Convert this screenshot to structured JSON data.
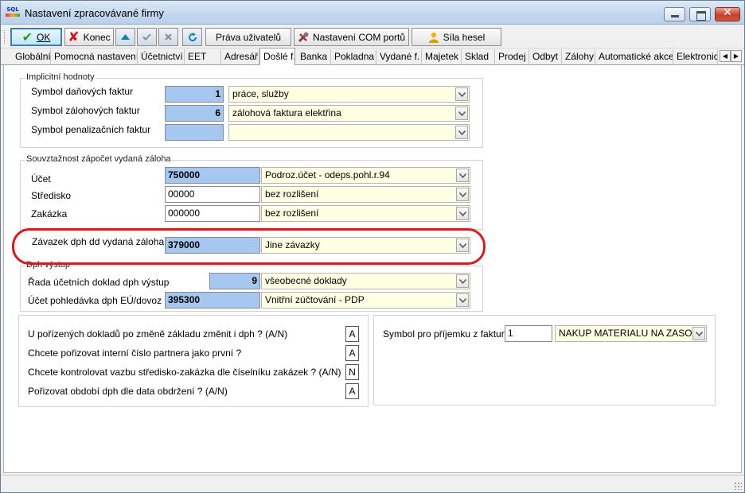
{
  "window": {
    "title": "Nastavení zpracovávané firmy",
    "app_icon_text": "SQL",
    "close_glyph": "✕"
  },
  "toolbar": {
    "ok_label": "OK",
    "konec_label": "Konec",
    "prava_label": "Práva uživatelů",
    "com_label": "Nastavení COM portů",
    "sila_label": "Síla hesel"
  },
  "tabs": [
    "Globální",
    "Pomocná nastavení",
    "Účetnictví",
    "EET",
    "Adresář",
    "Došlé f.",
    "Banka",
    "Pokladna",
    "Vydané f.",
    "Majetek",
    "Sklad",
    "Prodej",
    "Odbyt",
    "Zálohy",
    "Automatické akce",
    "Elektronick"
  ],
  "active_tab": "Došlé f.",
  "implicitni": {
    "title": "Implicitní hodnoty",
    "rows": [
      {
        "label": "Symbol daňových faktur",
        "value": "1",
        "option": "práce, služby"
      },
      {
        "label": "Symbol zálohových faktur",
        "value": "6",
        "option": "zálohová faktura elektřina"
      },
      {
        "label": "Symbol penalizačních faktur",
        "value": "",
        "option": ""
      }
    ]
  },
  "souvztaznost": {
    "title": "Souvztažnost zápočet vydaná záloha",
    "rows": [
      {
        "label": "Účet",
        "value": "750000",
        "option": "Podroz.účet - odeps.pohl.r.94"
      },
      {
        "label": "Středisko",
        "value": "00000",
        "option": "bez rozlišení"
      },
      {
        "label": "Zakázka",
        "value": "000000",
        "option": "bez rozlišení"
      }
    ]
  },
  "zavazek": {
    "label": "Závazek dph dd vydaná záloha",
    "value": "379000",
    "option": "Jine závazky"
  },
  "dph": {
    "title": "Dph výstup",
    "rada": {
      "label": "Řada účetních doklad dph výstup",
      "value": "9",
      "option": "všeobecné doklady"
    },
    "ucet": {
      "label": "Účet pohledávka dph EÚ/dovoz",
      "value": "395300",
      "option": "Vnitřní zúčtování - PDP"
    }
  },
  "questions": [
    {
      "text": "U pořízených dokladů po změně základu změnit i dph ? (A/N)",
      "value": "A"
    },
    {
      "text": "Chcete pořizovat interní číslo partnera jako první ?",
      "value": "A"
    },
    {
      "text": "Chcete kontrolovat vazbu středisko-zakázka dle číselníku zakázek ? (A/N)",
      "value": "N"
    },
    {
      "text": "Pořizovat období dph dle data obdržení ? (A/N)",
      "value": "A"
    }
  ],
  "prijemka": {
    "label": "Symbol pro příjemku z faktury",
    "value": "1",
    "option": "NAKUP MATERIALU NA ZASOBY"
  },
  "colors": {
    "accent_field": "#a6c8f0",
    "combo_bg": "#ffffe4",
    "highlight": "#d61a1f"
  }
}
